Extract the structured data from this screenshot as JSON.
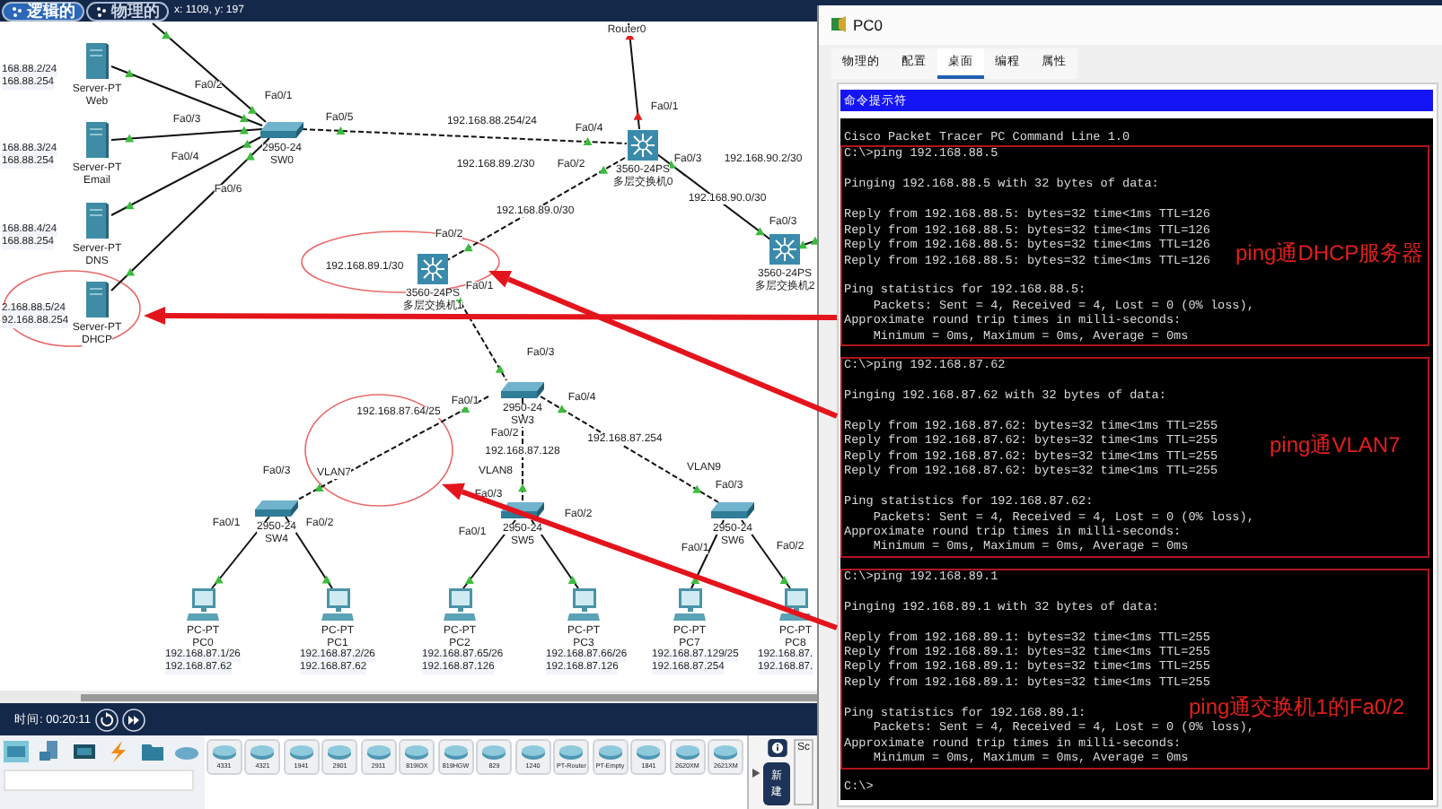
{
  "top_bar": {
    "modes": [
      {
        "label": "逻辑的",
        "selected": true
      },
      {
        "label": "物理的",
        "selected": false
      }
    ],
    "coordinates": "x: 1109, y: 197"
  },
  "topology": {
    "nodes": [
      {
        "kind": "server",
        "model": "Server-PT",
        "name": "Web",
        "addresses": [
          "168.88.2/24",
          "168.88.254"
        ]
      },
      {
        "kind": "server",
        "model": "Server-PT",
        "name": "Email",
        "addresses": [
          "168.88.3/24",
          "168.88.254"
        ]
      },
      {
        "kind": "server",
        "model": "Server-PT",
        "name": "DNS",
        "addresses": [
          "168.88.4/24",
          "168.88.254"
        ]
      },
      {
        "kind": "server",
        "model": "Server-PT",
        "name": "DHCP",
        "addresses": [
          "2.168.88.5/24",
          "92.168.88.254"
        ]
      },
      {
        "kind": "switch",
        "model": "2950-24",
        "name": "SW0"
      },
      {
        "kind": "router",
        "name": "Router0"
      },
      {
        "kind": "multilayer",
        "model": "3560-24PS",
        "name": "多层交换机0"
      },
      {
        "kind": "multilayer",
        "model": "3560-24PS",
        "name": "多层交换机1"
      },
      {
        "kind": "multilayer",
        "model": "3560-24PS",
        "name": "多层交换机2"
      },
      {
        "kind": "switch",
        "model": "2950-24",
        "name": "SW3"
      },
      {
        "kind": "switch",
        "model": "2950-24",
        "name": "SW4"
      },
      {
        "kind": "switch",
        "model": "2950-24",
        "name": "SW5"
      },
      {
        "kind": "switch",
        "model": "2950-24",
        "name": "SW6"
      },
      {
        "kind": "pc",
        "model": "PC-PT",
        "name": "PC0",
        "addresses": [
          "192.168.87.1/26",
          "192.168.87.62"
        ]
      },
      {
        "kind": "pc",
        "model": "PC-PT",
        "name": "PC1",
        "addresses": [
          "192.168.87.2/26",
          "192.168.87.62"
        ]
      },
      {
        "kind": "pc",
        "model": "PC-PT",
        "name": "PC2",
        "addresses": [
          "192.168.87.65/26",
          "192.168.87.126"
        ]
      },
      {
        "kind": "pc",
        "model": "PC-PT",
        "name": "PC3",
        "addresses": [
          "192.168.87.66/26",
          "192.168.87.126"
        ]
      },
      {
        "kind": "pc",
        "model": "PC-PT",
        "name": "PC7",
        "addresses": [
          "192.168.87.129/25",
          "192.168.87.254"
        ]
      },
      {
        "kind": "pc",
        "model": "PC-PT",
        "name": "PC8",
        "addresses": [
          "192.168.87.",
          "192.168.87."
        ]
      }
    ],
    "labels": [
      "Fa0/2",
      "Fa0/1",
      "Fa0/3",
      "Fa0/5",
      "192.168.88.254/24",
      "Fa0/4",
      "Fa0/1",
      "Fa0/4",
      "192.168.89.2/30",
      "Fa0/2",
      "Fa0/3",
      "192.168.90.2/30",
      "Fa0/6",
      "192.168.89.0/30",
      "192.168.90.0/30",
      "Fa0/3",
      "Fa0/2",
      "192.168.89.1/30",
      "Fa0/1",
      "Fa0/3",
      "Fa0/1",
      "192.168.87.64/25",
      "Fa0/4",
      "Fa0/2",
      "192.168.87.128",
      "192.168.87.254",
      "VLAN8",
      "VLAN9",
      "Fa0/3",
      "VLAN7",
      "Fa0/3",
      "Fa0/3",
      "Fa0/1",
      "Fa0/2",
      "Fa0/1",
      "Fa0/2",
      "Fa0/1",
      "Fa0/2"
    ]
  },
  "time_bar": {
    "time": "时间: 00:20:11"
  },
  "device_panel": {
    "devices": [
      "4331",
      "4321",
      "1941",
      "2901",
      "2911",
      "819IOX",
      "819HGW",
      "829",
      "1240",
      "PT-Router",
      "PT-Empty",
      "1841",
      "2620XM",
      "2621XM"
    ],
    "side_label": "Sc",
    "new_button": "新建"
  },
  "pc_window": {
    "title": "PC0",
    "tabs": [
      {
        "label": "物理的",
        "selected": false
      },
      {
        "label": "配置",
        "selected": false
      },
      {
        "label": "桌面",
        "selected": true
      },
      {
        "label": "编程",
        "selected": false
      },
      {
        "label": "属性",
        "selected": false
      }
    ],
    "panel_title": "命令提示符",
    "terminal": {
      "header": "Cisco Packet Tracer PC Command Line 1.0",
      "blocks": [
        {
          "command": "C:\\>ping 192.168.88.5",
          "pinging": "Pinging 192.168.88.5 with 32 bytes of data:",
          "replies": [
            "Reply from 192.168.88.5: bytes=32 time<1ms TTL=126",
            "Reply from 192.168.88.5: bytes=32 time<1ms TTL=126",
            "Reply from 192.168.88.5: bytes=32 time<1ms TTL=126",
            "Reply from 192.168.88.5: bytes=32 time<1ms TTL=126"
          ],
          "statistics": [
            "Ping statistics for 192.168.88.5:",
            "    Packets: Sent = 4, Received = 4, Lost = 0 (0% loss),",
            "Approximate round trip times in milli-seconds:",
            "    Minimum = 0ms, Maximum = 0ms, Average = 0ms"
          ],
          "annotation": "ping通DHCP服务器"
        },
        {
          "command": "C:\\>ping 192.168.87.62",
          "pinging": "Pinging 192.168.87.62 with 32 bytes of data:",
          "replies": [
            "Reply from 192.168.87.62: bytes=32 time<1ms TTL=255",
            "Reply from 192.168.87.62: bytes=32 time<1ms TTL=255",
            "Reply from 192.168.87.62: bytes=32 time<1ms TTL=255",
            "Reply from 192.168.87.62: bytes=32 time<1ms TTL=255"
          ],
          "statistics": [
            "Ping statistics for 192.168.87.62:",
            "    Packets: Sent = 4, Received = 4, Lost = 0 (0% loss),",
            "Approximate round trip times in milli-seconds:",
            "    Minimum = 0ms, Maximum = 0ms, Average = 0ms"
          ],
          "annotation": "ping通VLAN7"
        },
        {
          "command": "C:\\>ping 192.168.89.1",
          "pinging": "Pinging 192.168.89.1 with 32 bytes of data:",
          "replies": [
            "Reply from 192.168.89.1: bytes=32 time<1ms TTL=255",
            "Reply from 192.168.89.1: bytes=32 time<1ms TTL=255",
            "Reply from 192.168.89.1: bytes=32 time<1ms TTL=255",
            "Reply from 192.168.89.1: bytes=32 time<1ms TTL=255"
          ],
          "statistics": [
            "Ping statistics for 192.168.89.1:",
            "    Packets: Sent = 4, Received = 4, Lost = 0 (0% loss),",
            "Approximate round trip times in milli-seconds:",
            "    Minimum = 0ms, Maximum = 0ms, Average = 0ms"
          ],
          "annotation": "ping通交换机1的Fa0/2"
        }
      ],
      "prompt": "C:\\>"
    }
  }
}
